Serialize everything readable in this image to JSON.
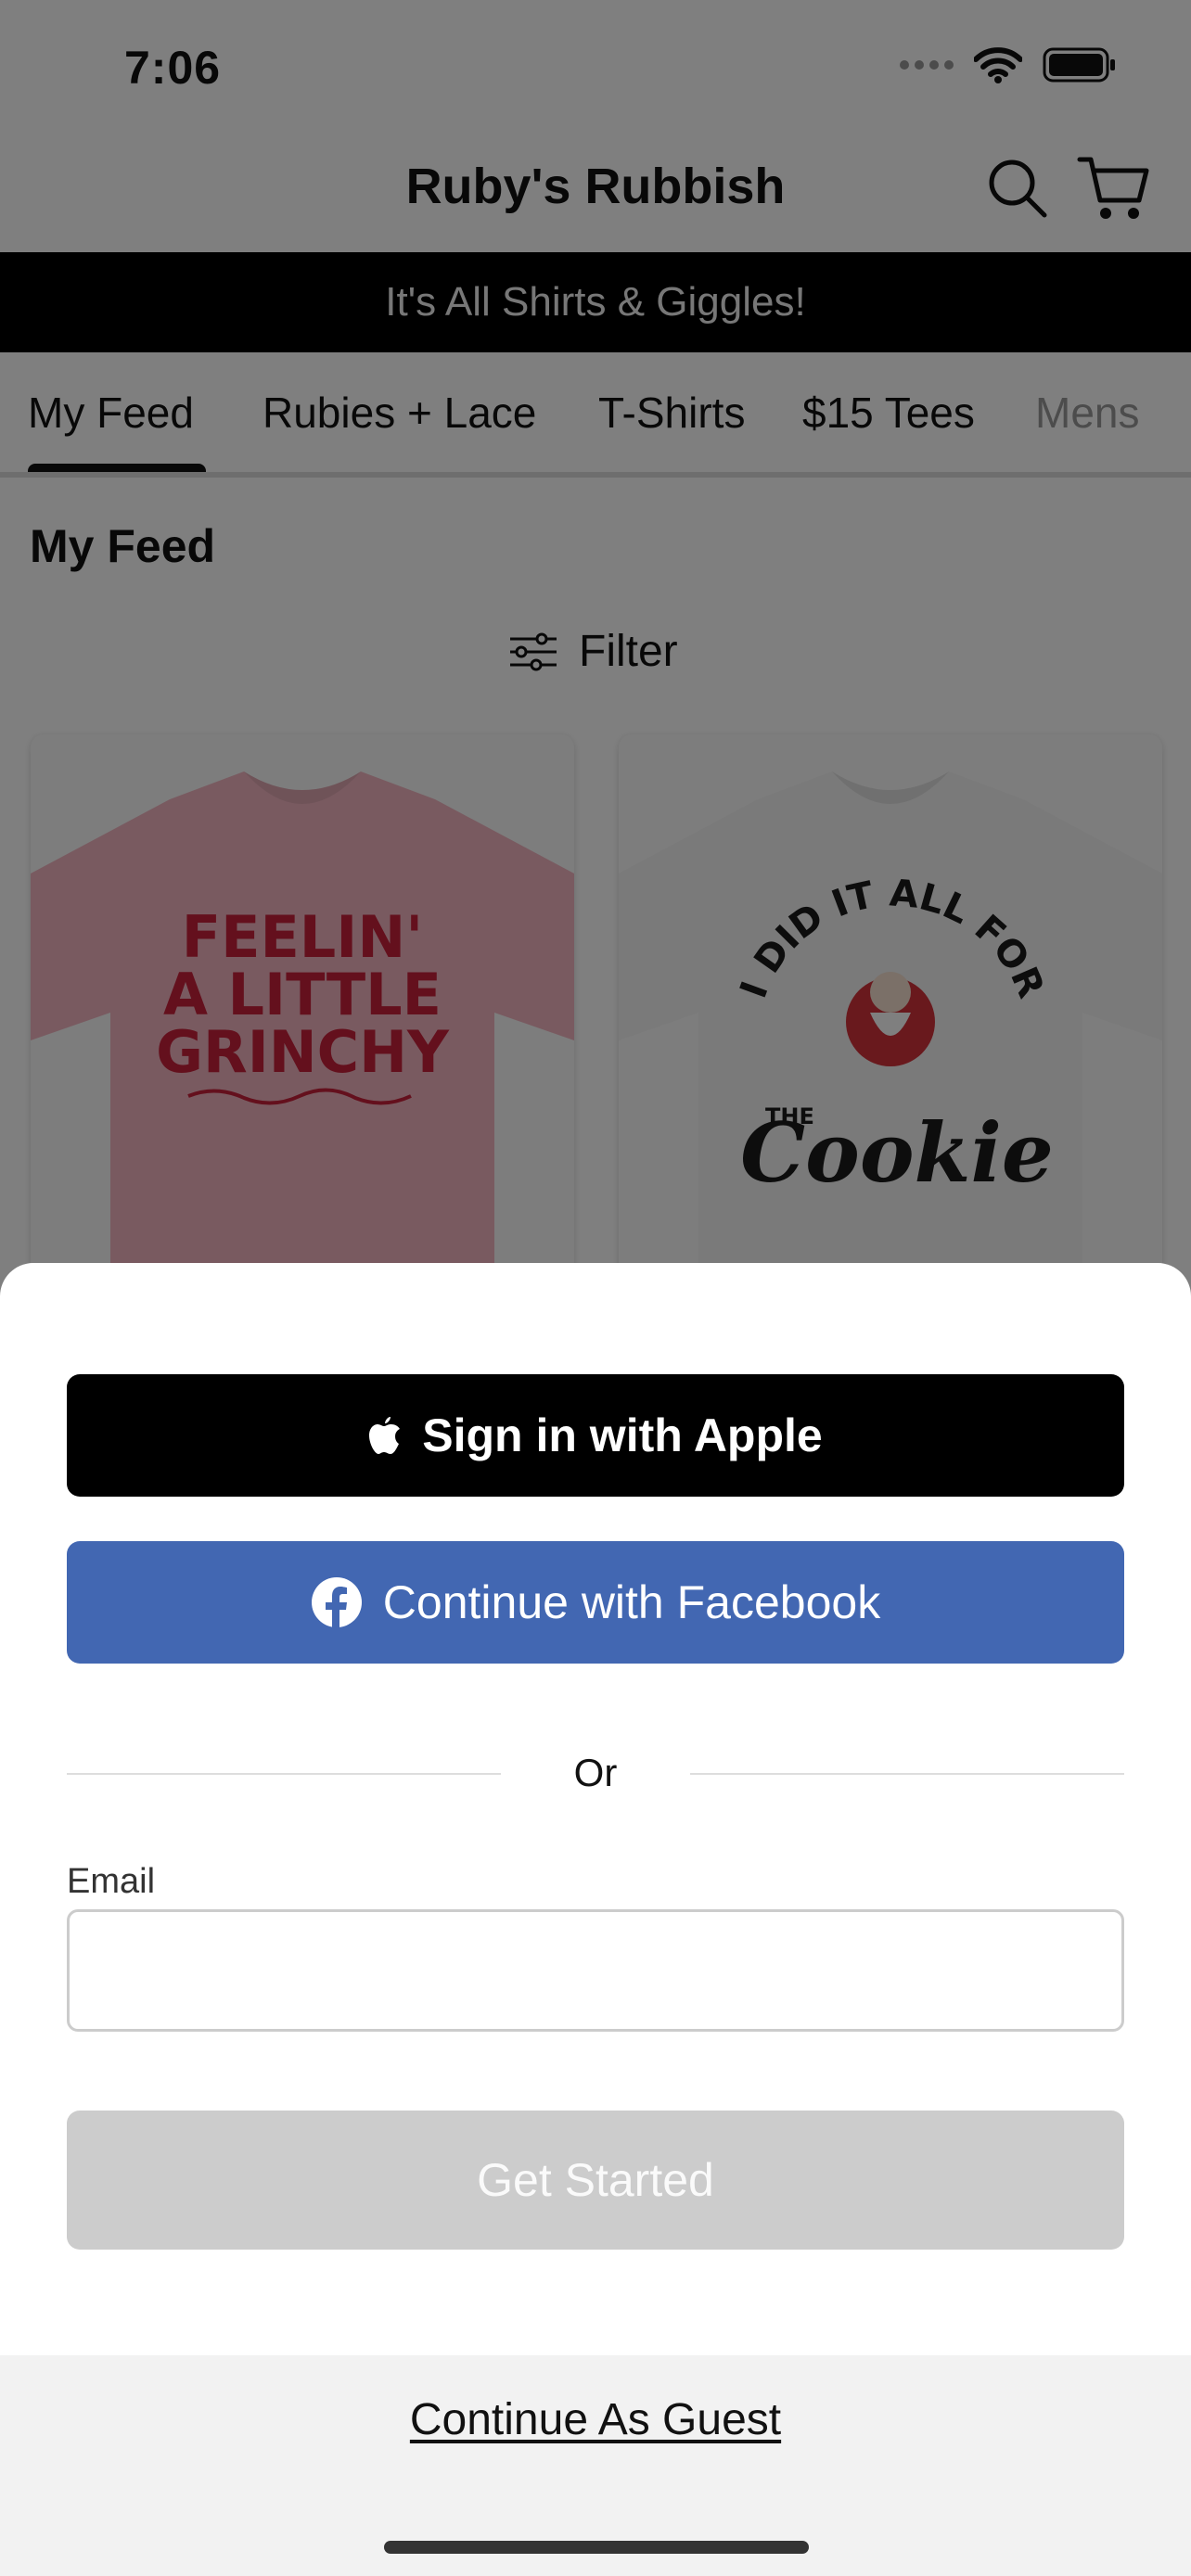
{
  "status_bar": {
    "time": "7:06"
  },
  "header": {
    "title": "Ruby's Rubbish"
  },
  "banner": {
    "text": "It's All Shirts & Giggles!"
  },
  "tabs": [
    {
      "label": "My Feed",
      "active": true
    },
    {
      "label": "Rubies + Lace"
    },
    {
      "label": "T-Shirts"
    },
    {
      "label": "$15 Tees"
    },
    {
      "label": "Mens"
    }
  ],
  "feed": {
    "title": "My Feed",
    "filter_label": "Filter",
    "products": [
      {
        "shirt_color": "#f2b5c1",
        "print_color": "#c8213a",
        "print_lines": [
          "FEELIN'",
          "A LITTLE",
          "GRINCHY"
        ]
      },
      {
        "shirt_color": "#f4f4f4",
        "print_color": "#1a1a1a",
        "print_lines": [
          "I DID IT ALL FOR",
          "THE",
          "Cookie"
        ]
      }
    ]
  },
  "sheet": {
    "apple_label": "Sign in with Apple",
    "facebook_label": "Continue with Facebook",
    "or_label": "Or",
    "email_label": "Email",
    "email_value": "",
    "get_started_label": "Get Started",
    "guest_label": "Continue As Guest"
  },
  "colors": {
    "facebook_blue": "#4267b2",
    "disabled_gray": "#cccccc",
    "banner_black": "#000000"
  }
}
